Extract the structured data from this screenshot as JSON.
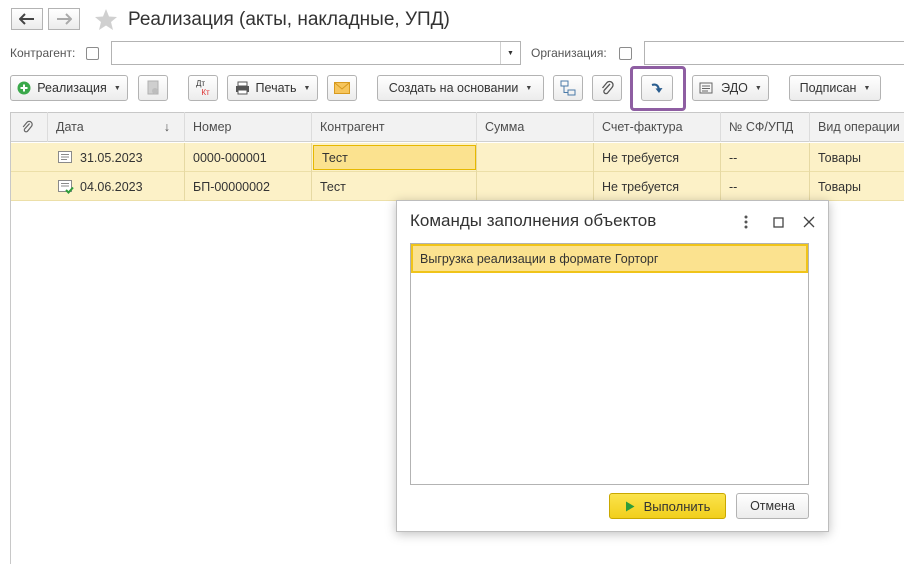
{
  "window": {
    "title": "Реализация (акты, накладные, УПД)"
  },
  "filters": {
    "counterparty_label": "Контрагент:",
    "counterparty_value": "",
    "organization_label": "Организация:",
    "organization_value": ""
  },
  "toolbar": {
    "create_label": "Реализация",
    "print_label": "Печать",
    "dt_label": "Дт",
    "kt_label": "Кт",
    "create_based_label": "Создать на основании",
    "edo_label": "ЭДО",
    "signed_label": "Подписан"
  },
  "table": {
    "columns": [
      "Дата",
      "Номер",
      "Контрагент",
      "Сумма",
      "Счет-фактура",
      "№ СФ/УПД",
      "Вид операции"
    ],
    "sort_indicator": "↓",
    "rows": [
      {
        "date": "31.05.2023",
        "number": "0000-000001",
        "counterparty": "Тест",
        "sum": "",
        "invoice": "Не требуется",
        "sf_num": "--",
        "operation": "Товары"
      },
      {
        "date": "04.06.2023",
        "number": "БП-00000002",
        "counterparty": "Тест",
        "sum": "",
        "invoice": "Не требуется",
        "sf_num": "--",
        "operation": "Товары"
      }
    ]
  },
  "dialog": {
    "title": "Команды заполнения объектов",
    "items": [
      "Выгрузка реализации в формате Горторг"
    ],
    "run_label": "Выполнить",
    "cancel_label": "Отмена"
  },
  "colors": {
    "selection_row": "#fcf1c7",
    "highlight_border": "#8e5ea2",
    "primary_button": "#f5d83a"
  }
}
